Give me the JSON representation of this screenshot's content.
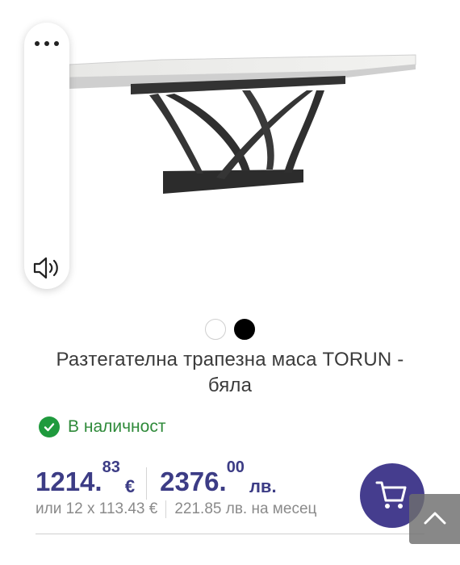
{
  "product": {
    "title": "Разтегателна трапезна маса TORUN - бяла",
    "color_options": [
      "white",
      "black"
    ],
    "selected_color": "black"
  },
  "side_menu": {
    "more_icon": "more-dots-icon",
    "sound_icon": "speaker-icon"
  },
  "stock": {
    "text": "В наличност",
    "color": "#2f8a3a"
  },
  "price": {
    "eur_whole": "1214.",
    "eur_cents": "83",
    "eur_symbol": "€",
    "bgn_whole": "2376.",
    "bgn_cents": "00",
    "bgn_symbol": "лв.",
    "color": "#3c3c85"
  },
  "installment": {
    "eur_text": "или 12 x 113.43 €",
    "bgn_text": "221.85 лв. на месец"
  },
  "cart": {
    "icon": "cart-icon",
    "color": "#453d8e"
  },
  "scroll_top": {
    "icon": "chevron-up-icon"
  }
}
